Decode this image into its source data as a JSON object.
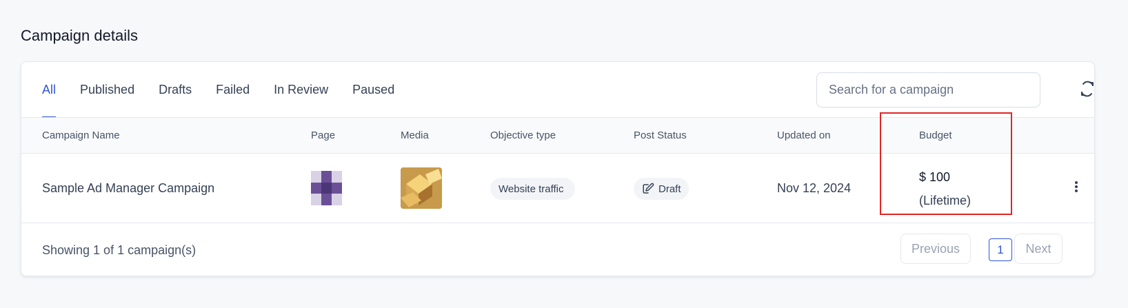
{
  "page": {
    "title": "Campaign details"
  },
  "tabs": [
    {
      "label": "All",
      "active": true
    },
    {
      "label": "Published",
      "active": false
    },
    {
      "label": "Drafts",
      "active": false
    },
    {
      "label": "Failed",
      "active": false
    },
    {
      "label": "In Review",
      "active": false
    },
    {
      "label": "Paused",
      "active": false
    }
  ],
  "search": {
    "placeholder": "Search for a campaign",
    "value": ""
  },
  "toolbar": {
    "refresh_icon": "refresh-icon"
  },
  "table": {
    "headers": [
      "Campaign Name",
      "Page",
      "Media",
      "Objective type",
      "Post Status",
      "Updated on",
      "Budget"
    ],
    "rows": [
      {
        "campaign_name": "Sample Ad Manager Campaign",
        "page_icon": "pixelated-page-avatar",
        "media_icon": "gold-boxes-thumbnail",
        "objective_type": "Website traffic",
        "post_status": "Draft",
        "post_status_icon": "edit-icon",
        "updated_on": "Nov 12, 2024",
        "budget": "$ 100",
        "budget_period": "(Lifetime)",
        "more_icon": "more-vertical-icon"
      }
    ]
  },
  "footer": {
    "showing_text": "Showing 1 of 1 campaign(s)",
    "previous_label": "Previous",
    "current_page": "1",
    "next_label": "Next"
  },
  "colors": {
    "accent": "#3056d3",
    "highlight": "#e02424",
    "pixel_avatar_dark": "#4b3576",
    "pixel_avatar_mid": "#6a4f97",
    "pixel_avatar_light": "#d9d2e6"
  }
}
